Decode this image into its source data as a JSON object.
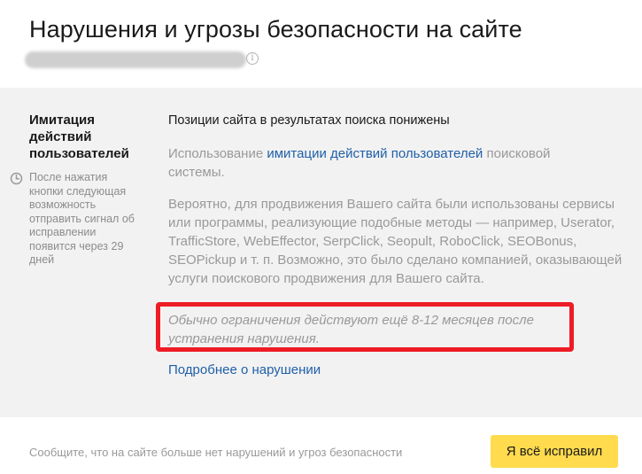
{
  "header": {
    "title": "Нарушения и угрозы безопасности на сайте",
    "info_icon_glyph": "i"
  },
  "sidebar": {
    "violation_type": "Имитация действий пользователей",
    "note": "После нажатия кнопки следующая возможность отправить сигнал об исправлении появится через 29 дней",
    "note_icon": "clock-icon"
  },
  "content": {
    "title": "Позиции сайта в результатах поиска понижены",
    "p1_before": "Использование ",
    "p1_link": "имитации действий пользователей",
    "p1_after": " поисковой системы.",
    "p2": "Вероятно, для продвижения Вашего сайта были использованы сервисы или программы, реализующие подобные методы — например, Userator, TrafficStore, WebEffector, SerpClick, Seopult, RoboClick, SEOBonus, SEOPickup и т. п. Возможно, это было сделано компанией, оказывающей услуги поискового продвижения для Вашего сайта.",
    "p3": "Обычно ограничения действуют ещё 8-12 месяцев после устранения нарушения.",
    "more_link": "Подробнее о нарушении"
  },
  "footer": {
    "text": "Сообщите, что на сайте больше нет нарушений и угроз безопасности",
    "button_label": "Я всё исправил"
  },
  "colors": {
    "panel_bg": "#f2f2f2",
    "link": "#2060a8",
    "highlight_border": "#ee1c25",
    "button_bg": "#ffdb4d"
  }
}
